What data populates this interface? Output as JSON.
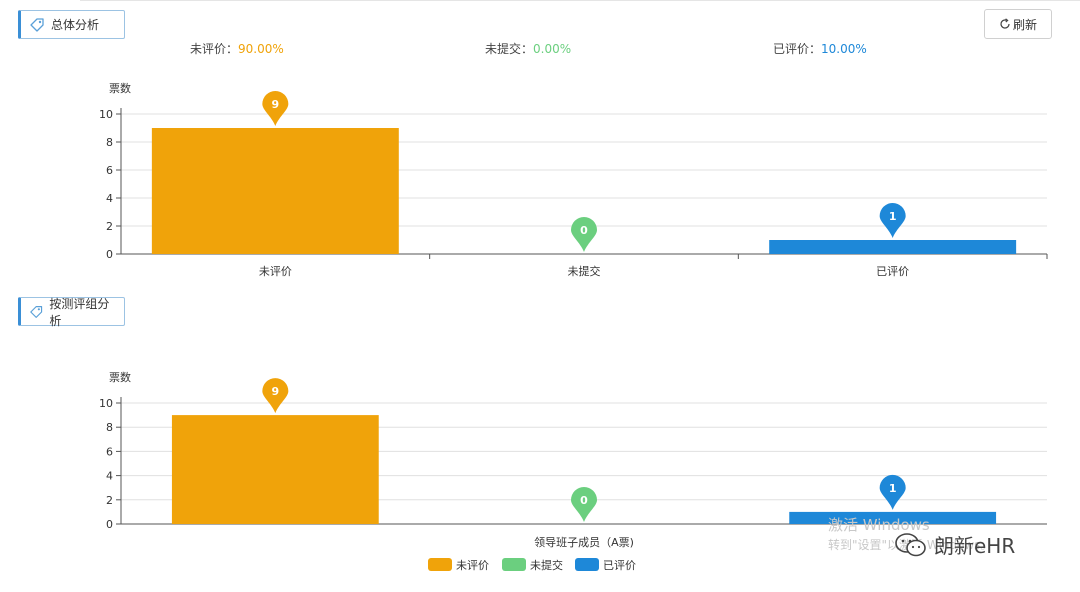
{
  "section1": {
    "title": "总体分析"
  },
  "section2": {
    "title": "按测评组分析"
  },
  "toolbar": {
    "refresh_label": "刷新"
  },
  "stats": [
    {
      "label": "未评价：",
      "value": "90.00%",
      "color": "#f0a30a"
    },
    {
      "label": "未提交：",
      "value": "0.00%",
      "color": "#6bcf7f"
    },
    {
      "label": "已评价：",
      "value": "10.00%",
      "color": "#1e88d8"
    }
  ],
  "chart_data": [
    {
      "type": "bar",
      "ylabel": "票数",
      "ylim": [
        0,
        10
      ],
      "yticks": [
        0,
        2,
        4,
        6,
        8,
        10
      ],
      "categories": [
        "未评价",
        "未提交",
        "已评价"
      ],
      "values": [
        9,
        0,
        1
      ],
      "colors": [
        "#f0a30a",
        "#6bcf7f",
        "#1e88d8"
      ],
      "markers": "pin labels above each bar showing value",
      "grid": true
    },
    {
      "type": "bar",
      "ylabel": "票数",
      "ylim": [
        0,
        10
      ],
      "yticks": [
        0,
        2,
        4,
        6,
        8,
        10
      ],
      "categories": [
        "领导班子成员（A票)"
      ],
      "series": [
        {
          "name": "未评价",
          "values": [
            9
          ],
          "color": "#f0a30a"
        },
        {
          "name": "未提交",
          "values": [
            0
          ],
          "color": "#6bcf7f"
        },
        {
          "name": "已评价",
          "values": [
            1
          ],
          "color": "#1e88d8"
        }
      ],
      "legend": "bottom-center",
      "grid": true
    }
  ],
  "watermark": {
    "line1": "激活 Windows",
    "line2": "转到\"设置\"以激活 Windows。"
  },
  "brand": {
    "name": "朗新eHR"
  }
}
